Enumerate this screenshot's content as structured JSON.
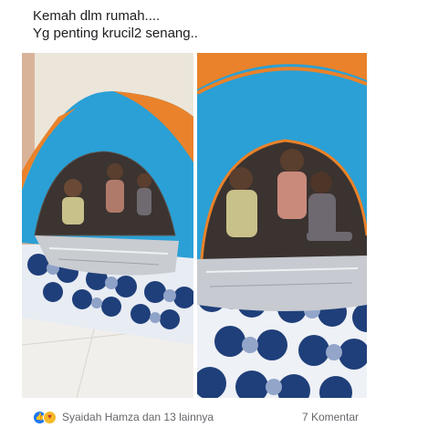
{
  "post": {
    "caption_line1": "Kemah dlm rumah....",
    "caption_line2": "Yg penting krucil2 senang.."
  },
  "photos": [
    {
      "subject": "children-in-tent-photo-1"
    },
    {
      "subject": "children-in-tent-photo-2"
    }
  ],
  "footer": {
    "reaction_icons": [
      "like-icon",
      "care-icon"
    ],
    "reactors_text": "Syaidah Hamza dan 13 lainnya",
    "comments_text": "7 Komentar"
  },
  "colors": {
    "tent_blue": "#2aa0d6",
    "tent_orange": "#e9822a",
    "rug_navy": "#1f3f7a",
    "like_blue": "#1877f2",
    "meta_text": "#65676b"
  }
}
